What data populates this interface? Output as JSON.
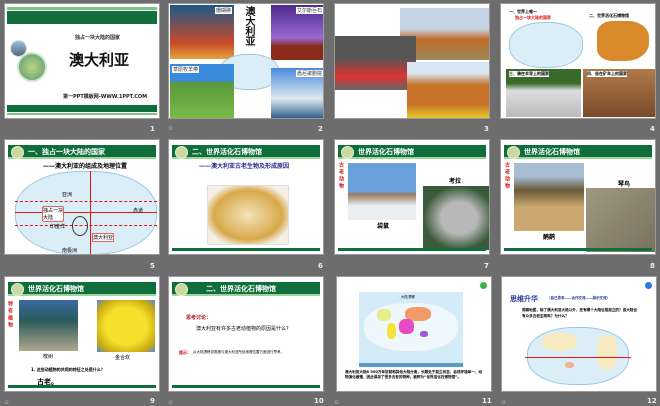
{
  "slides": [
    {
      "number": "1",
      "subtitle": "独占一块大陆的国家",
      "title": "澳大利亚",
      "footer": "第一PPT模板网-WWW.1PPT.COM"
    },
    {
      "number": "2",
      "title": "澳大利亚",
      "labels": [
        "珊瑚礁",
        "艾尔斯巨石",
        "草原牧羊带",
        "悉尼歌剧院"
      ]
    },
    {
      "number": "3"
    },
    {
      "number": "4",
      "items": [
        "一、世界上唯一",
        "独占一块大陆的国家",
        "二、世界活化石博物馆",
        "三、骑在羊背上的国家",
        "四、坐在矿车上的国家"
      ]
    },
    {
      "number": "5",
      "header": "一、独占一块大陆的国家",
      "subheader": "——澳大利亚的组成及地理位置",
      "labels": [
        "亚洲",
        "赤道",
        "独占一块大陆",
        "印度洋",
        "澳大利亚",
        "南极洲"
      ]
    },
    {
      "number": "6",
      "header": "二、世界活化石博物馆",
      "subheader": "——澳大利亚古老生物及形成原因"
    },
    {
      "number": "7",
      "header": "世界活化石博物馆",
      "side": "古老动物",
      "labels": [
        "考拉",
        "袋鼠"
      ]
    },
    {
      "number": "8",
      "header": "世界活化石博物馆",
      "side": "古老动物",
      "labels": [
        "琴鸟",
        "鸸鹋"
      ]
    },
    {
      "number": "9",
      "header": "世界活化石博物馆",
      "side": "特有植物",
      "labels": [
        "桉树",
        "金合欢"
      ],
      "question": "1. 这些动植物的共同的特征之处是什么？",
      "answer": "古老。"
    },
    {
      "number": "10",
      "header": "二、世界活化石博物馆",
      "discuss": "思考讨论：",
      "question": "澳大利亚有许多古老动植物的原因是什么？",
      "hint_label": "提示：",
      "hint": "从大陆漂移说角度与澳大利亚所处地理位置方面进行思考。"
    },
    {
      "number": "11",
      "map_title": "大陆漂移",
      "text": "澳大利亚大陆6 500万年前就和其他大陆分离，长期处于孤立状态，自然环境单一，动物演化缓慢，因此保存了很多古老的物种，被称为“世界活化石博物馆”。"
    },
    {
      "number": "12",
      "title": "思维升华",
      "title_note": "（自己思考——合作交流——展示交流）",
      "text": "观察地图，除了澳大利亚大陆以外，还有哪个大陆也是孤立的？该大陆也有众多古老生物吗？为什么？"
    }
  ],
  "colors": {
    "green": "#0f6e3c",
    "red": "#e01818",
    "background": "#6d6d6d"
  }
}
